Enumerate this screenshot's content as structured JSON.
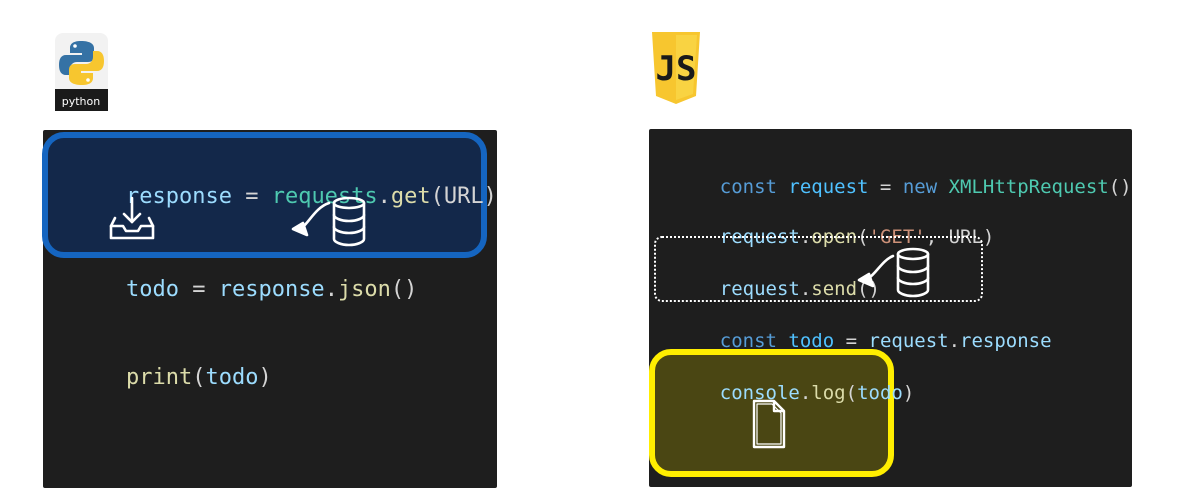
{
  "python": {
    "logo_label": "python",
    "lines": [
      [
        {
          "t": "response",
          "c": "t-var"
        },
        {
          "t": " = ",
          "c": "t-op"
        },
        {
          "t": "requests",
          "c": "t-cls"
        },
        {
          "t": ".",
          "c": "t-op"
        },
        {
          "t": "get",
          "c": "t-fn"
        },
        {
          "t": "(URL)",
          "c": "t-plain"
        }
      ],
      [
        {
          "t": "todo",
          "c": "t-var"
        },
        {
          "t": " = ",
          "c": "t-op"
        },
        {
          "t": "response",
          "c": "t-var"
        },
        {
          "t": ".",
          "c": "t-op"
        },
        {
          "t": "json",
          "c": "t-fn"
        },
        {
          "t": "()",
          "c": "t-plain"
        }
      ],
      [
        {
          "t": "print",
          "c": "t-fn"
        },
        {
          "t": "(",
          "c": "t-plain"
        },
        {
          "t": "todo",
          "c": "t-var"
        },
        {
          "t": ")",
          "c": "t-plain"
        }
      ]
    ]
  },
  "javascript": {
    "logo_label": "JS",
    "lines": [
      [
        {
          "t": "const ",
          "c": "t-kw"
        },
        {
          "t": "request",
          "c": "t-const"
        },
        {
          "t": " = ",
          "c": "t-op"
        },
        {
          "t": "new ",
          "c": "t-kw"
        },
        {
          "t": "XMLHttpRequest",
          "c": "t-cls"
        },
        {
          "t": "()",
          "c": "t-plain"
        }
      ],
      [
        {
          "t": "request",
          "c": "t-var"
        },
        {
          "t": ".",
          "c": "t-op"
        },
        {
          "t": "open",
          "c": "t-fn"
        },
        {
          "t": "(",
          "c": "t-plain"
        },
        {
          "t": "'GET'",
          "c": "t-str"
        },
        {
          "t": ", URL)",
          "c": "t-plain"
        }
      ],
      [
        {
          "t": "request",
          "c": "t-var"
        },
        {
          "t": ".",
          "c": "t-op"
        },
        {
          "t": "send",
          "c": "t-fn"
        },
        {
          "t": "()",
          "c": "t-plain"
        }
      ],
      [
        {
          "t": "const ",
          "c": "t-kw"
        },
        {
          "t": "todo",
          "c": "t-const"
        },
        {
          "t": " = ",
          "c": "t-op"
        },
        {
          "t": "request",
          "c": "t-var"
        },
        {
          "t": ".",
          "c": "t-op"
        },
        {
          "t": "response",
          "c": "t-var"
        }
      ],
      [
        {
          "t": "console",
          "c": "t-var"
        },
        {
          "t": ".",
          "c": "t-op"
        },
        {
          "t": "log",
          "c": "t-fn"
        },
        {
          "t": "(",
          "c": "t-plain"
        },
        {
          "t": "todo",
          "c": "t-var"
        },
        {
          "t": ")",
          "c": "t-plain"
        }
      ]
    ]
  },
  "icons": {
    "py_inbox": "inbox-download-icon",
    "py_database": "database-icon",
    "js_database": "database-icon",
    "js_document": "document-icon"
  },
  "colors": {
    "panel_bg": "#1e1e1e",
    "python_highlight": "#1565c0",
    "javascript_highlight": "#ffee00",
    "dotted_box": "#ffffff"
  }
}
